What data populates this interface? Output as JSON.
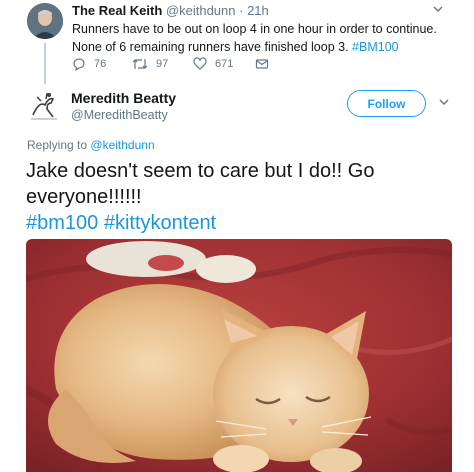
{
  "reply_tweet": {
    "display_name": "The Real Keith",
    "handle": "@keithdunn",
    "time": "· 21h",
    "text_main": "Runners have to be out on loop 4 in one hour in order to continue. None of 6 remaining runners have finished loop 3.",
    "hashtag": "#BM100",
    "replies": "76",
    "retweets": "97",
    "likes": "671"
  },
  "main_tweet": {
    "display_name": "Meredith Beatty",
    "handle": "@MeredithBeatty",
    "follow_label": "Follow",
    "replying_prefix": "Replying to",
    "replying_handle": "@keithdunn",
    "text": "Jake doesn't seem to care but I do!! Go everyone!!!!!!",
    "hashtags": "#bm100 #kittykontent",
    "photo_icon": "cat-photo"
  },
  "colors": {
    "accent": "#1da1f2",
    "link": "#1b95e0",
    "text": "#14171a",
    "muted": "#657786"
  }
}
